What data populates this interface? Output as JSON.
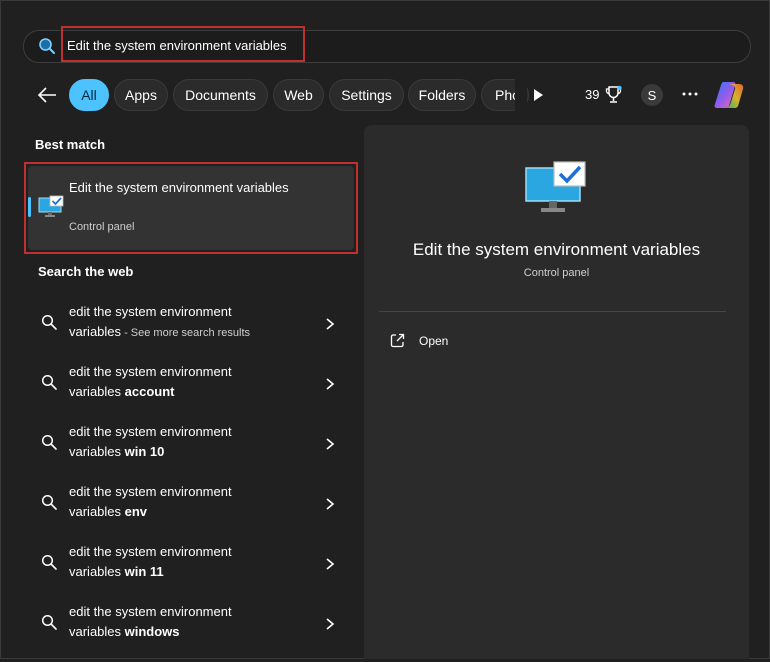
{
  "search": {
    "query": "Edit the system environment variables"
  },
  "filters": {
    "chips": [
      {
        "label": "All",
        "active": true
      },
      {
        "label": "Apps"
      },
      {
        "label": "Documents"
      },
      {
        "label": "Web"
      },
      {
        "label": "Settings"
      },
      {
        "label": "Folders"
      },
      {
        "label": "Pho"
      }
    ],
    "points": "39",
    "avatar_initial": "S"
  },
  "best_match": {
    "heading": "Best match",
    "title": "Edit the system environment variables",
    "subtitle": "Control panel"
  },
  "web": {
    "heading": "Search the web",
    "items": [
      {
        "line1": "edit the system environment",
        "line2": "variables",
        "suffix": "",
        "extra": " - See more search results"
      },
      {
        "line1": "edit the system environment",
        "line2": "variables ",
        "suffix": "account",
        "extra": ""
      },
      {
        "line1": "edit the system environment",
        "line2": "variables ",
        "suffix": "win 10",
        "extra": ""
      },
      {
        "line1": "edit the system environment",
        "line2": "variables ",
        "suffix": "env",
        "extra": ""
      },
      {
        "line1": "edit the system environment",
        "line2": "variables ",
        "suffix": "win 11",
        "extra": ""
      },
      {
        "line1": "edit the system environment",
        "line2": "variables ",
        "suffix": "windows",
        "extra": ""
      }
    ]
  },
  "preview": {
    "title": "Edit the system environment variables",
    "subtitle": "Control panel",
    "actions": [
      {
        "label": "Open",
        "icon": "open-external-icon"
      }
    ]
  },
  "colors": {
    "accent": "#4cc2ff",
    "highlight_box": "#c0302f",
    "background": "#202020"
  }
}
